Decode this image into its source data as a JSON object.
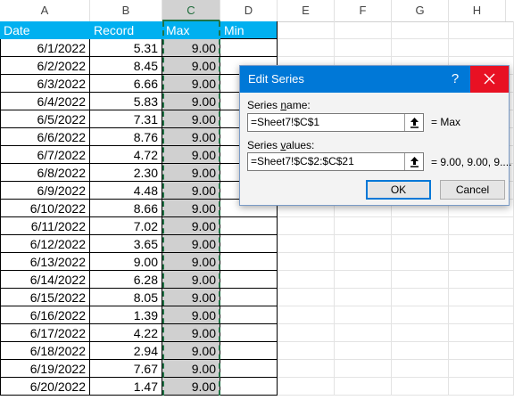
{
  "columns": [
    "A",
    "B",
    "C",
    "D",
    "E",
    "F",
    "G",
    "H"
  ],
  "headers": {
    "date": "Date",
    "record": "Record",
    "max": "Max",
    "min": "Min"
  },
  "rows": [
    {
      "date": "6/1/2022",
      "record": "5.31",
      "max": "9.00"
    },
    {
      "date": "6/2/2022",
      "record": "8.45",
      "max": "9.00"
    },
    {
      "date": "6/3/2022",
      "record": "6.66",
      "max": "9.00"
    },
    {
      "date": "6/4/2022",
      "record": "5.83",
      "max": "9.00"
    },
    {
      "date": "6/5/2022",
      "record": "7.31",
      "max": "9.00"
    },
    {
      "date": "6/6/2022",
      "record": "8.76",
      "max": "9.00"
    },
    {
      "date": "6/7/2022",
      "record": "4.72",
      "max": "9.00"
    },
    {
      "date": "6/8/2022",
      "record": "2.30",
      "max": "9.00"
    },
    {
      "date": "6/9/2022",
      "record": "4.48",
      "max": "9.00"
    },
    {
      "date": "6/10/2022",
      "record": "8.66",
      "max": "9.00"
    },
    {
      "date": "6/11/2022",
      "record": "7.02",
      "max": "9.00"
    },
    {
      "date": "6/12/2022",
      "record": "3.65",
      "max": "9.00"
    },
    {
      "date": "6/13/2022",
      "record": "9.00",
      "max": "9.00"
    },
    {
      "date": "6/14/2022",
      "record": "6.28",
      "max": "9.00"
    },
    {
      "date": "6/15/2022",
      "record": "8.05",
      "max": "9.00"
    },
    {
      "date": "6/16/2022",
      "record": "1.39",
      "max": "9.00"
    },
    {
      "date": "6/17/2022",
      "record": "4.22",
      "max": "9.00"
    },
    {
      "date": "6/18/2022",
      "record": "2.94",
      "max": "9.00"
    },
    {
      "date": "6/19/2022",
      "record": "7.67",
      "max": "9.00"
    },
    {
      "date": "6/20/2022",
      "record": "1.47",
      "max": "9.00"
    }
  ],
  "dialog": {
    "title": "Edit Series",
    "help": "?",
    "close_icon": "close-icon",
    "series_name_label_prefix": "Series ",
    "series_name_label_accel": "n",
    "series_name_label_suffix": "ame:",
    "series_name_value": "=Sheet7!$C$1",
    "series_name_preview": "= Max",
    "series_values_label_prefix": "Series ",
    "series_values_label_accel": "v",
    "series_values_label_suffix": "alues:",
    "series_values_value": "=Sheet7!$C$2:$C$21",
    "series_values_preview": "= 9.00, 9.00, 9....",
    "ok_label": "OK",
    "cancel_label": "Cancel"
  },
  "colors": {
    "header_fill": "#00b0f0",
    "selection_border": "#217346",
    "dialog_title": "#0078d7",
    "close_red": "#e81123"
  }
}
